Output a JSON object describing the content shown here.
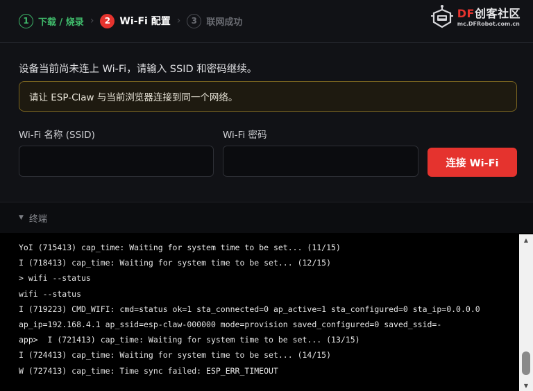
{
  "steps": [
    {
      "num": "1",
      "label": "下载 / 烧录",
      "state": "done"
    },
    {
      "num": "2",
      "label": "Wi-Fi 配置",
      "state": "active"
    },
    {
      "num": "3",
      "label": "联网成功",
      "state": "pending"
    }
  ],
  "logo": {
    "brand_prefix": "DF",
    "brand_rest": "创客社区",
    "url": "mc.DFRobot.com.cn"
  },
  "wifi": {
    "prompt": "设备当前尚未连上 Wi-Fi，请输入 SSID 和密码继续。",
    "notice": "请让 ESP-Claw 与当前浏览器连接到同一个网络。",
    "ssid_label": "Wi-Fi 名称 (SSID)",
    "ssid_value": "",
    "password_label": "Wi-Fi 密码",
    "password_value": "",
    "connect_label": "连接 Wi-Fi"
  },
  "terminal": {
    "title": "终端",
    "lines": [
      "YoI (715413) cap_time: Waiting for system time to be set... (11/15)",
      "I (718413) cap_time: Waiting for system time to be set... (12/15)",
      "> wifi --status",
      "wifi --status",
      "I (719223) CMD_WIFI: cmd=status ok=1 sta_connected=0 ap_active=1 sta_configured=0 sta_ip=0.0.0.0",
      "ap_ip=192.168.4.1 ap_ssid=esp-claw-000000 mode=provision saved_configured=0 saved_ssid=-",
      "app>  I (721413) cap_time: Waiting for system time to be set... (13/15)",
      "I (724413) cap_time: Waiting for system time to be set... (14/15)",
      "W (727413) cap_time: Time sync failed: ESP_ERR_TIMEOUT"
    ]
  },
  "colors": {
    "accent": "#e5332e",
    "success": "#3fb96a",
    "notice_border": "#7a6420"
  }
}
